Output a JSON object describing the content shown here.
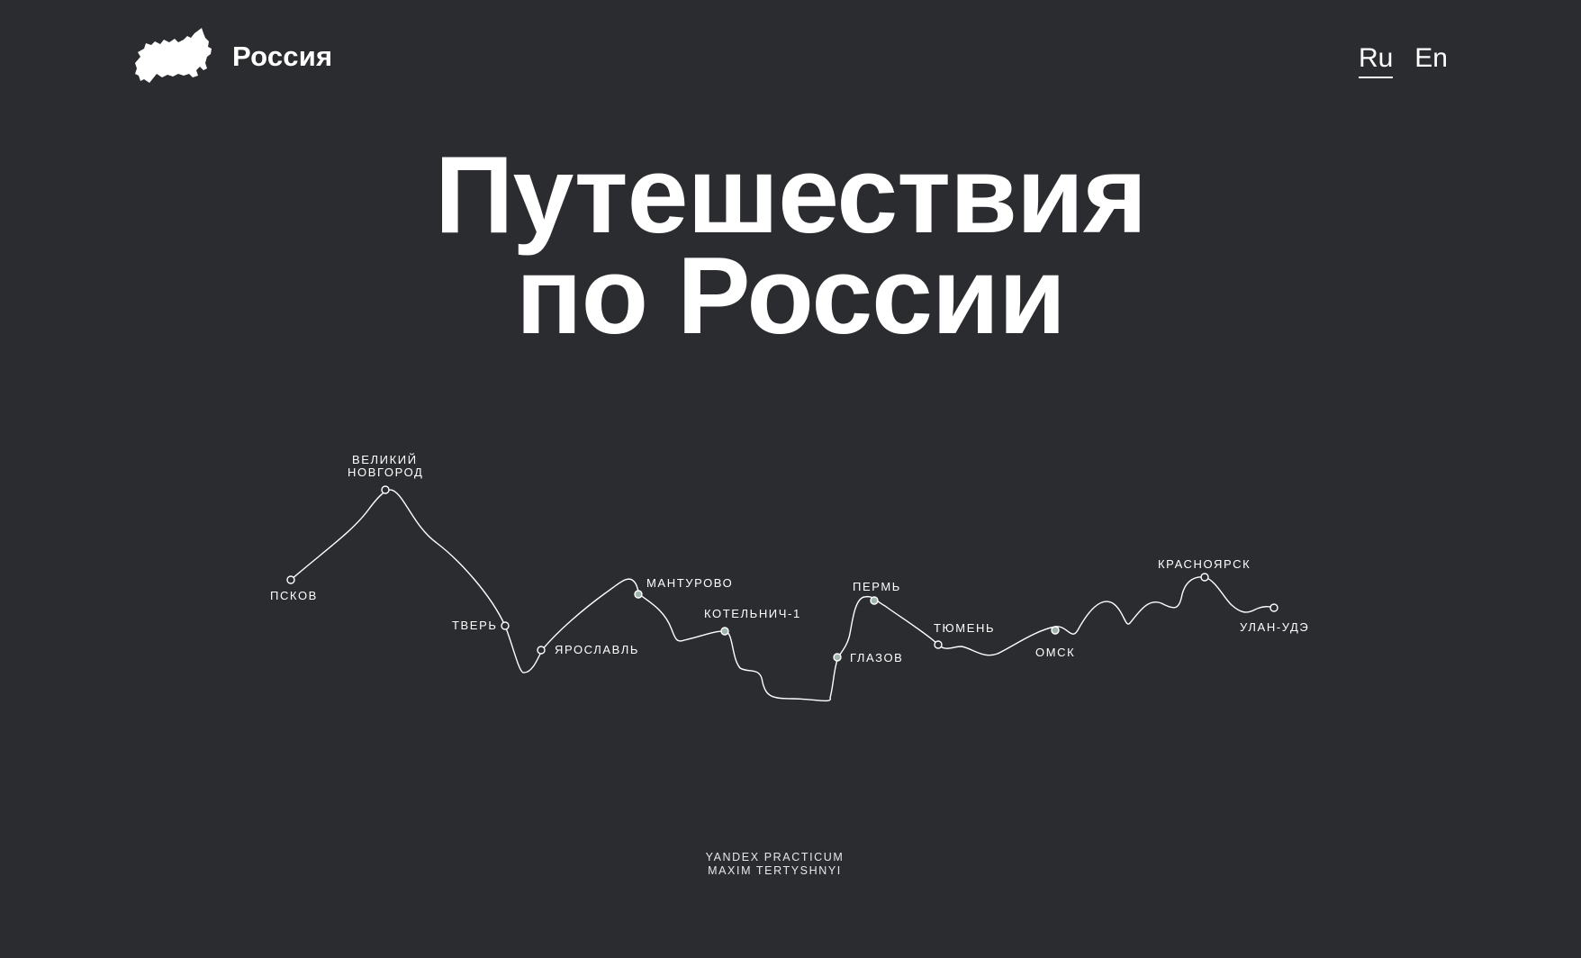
{
  "header": {
    "logo_text": "Россия",
    "logo_icon": "russia-map-icon",
    "languages": [
      {
        "label": "Ru",
        "active": true
      },
      {
        "label": "En",
        "active": false
      }
    ]
  },
  "hero": {
    "title_line1": "Путешествия",
    "title_line2": "по России"
  },
  "route": {
    "cities": [
      {
        "id": "pskov",
        "label_lines": [
          "ПСКОВ"
        ]
      },
      {
        "id": "velikiy-novgorod",
        "label_lines": [
          "ВЕЛИКИЙ",
          "НОВГОРОД"
        ]
      },
      {
        "id": "tver",
        "label_lines": [
          "ТВЕРЬ"
        ]
      },
      {
        "id": "yaroslavl",
        "label_lines": [
          "ЯРОСЛАВЛЬ"
        ]
      },
      {
        "id": "manturovo",
        "label_lines": [
          "МАНТУРОВО"
        ]
      },
      {
        "id": "kotelnich",
        "label_lines": [
          "КОТЕЛЬНИЧ-1"
        ]
      },
      {
        "id": "glazov",
        "label_lines": [
          "ГЛАЗОВ"
        ]
      },
      {
        "id": "perm",
        "label_lines": [
          "ПЕРМЬ"
        ]
      },
      {
        "id": "tyumen",
        "label_lines": [
          "ТЮМЕНЬ"
        ]
      },
      {
        "id": "omsk",
        "label_lines": [
          "ОМСК"
        ]
      },
      {
        "id": "krasnoyarsk",
        "label_lines": [
          "КРАСНОЯРСК"
        ]
      },
      {
        "id": "ulan-ude",
        "label_lines": [
          "УЛАН-УДЭ"
        ]
      }
    ],
    "line_color": "#ffffff",
    "marker_fill": "#2b2c30",
    "marker_fill_active": "#9fb5ad"
  },
  "footer": {
    "line1": "YANDEX PRACTICUM",
    "line2": "MAXIM TERTYSHNYI"
  },
  "colors": {
    "background": "#2b2c30",
    "text": "#ffffff"
  }
}
